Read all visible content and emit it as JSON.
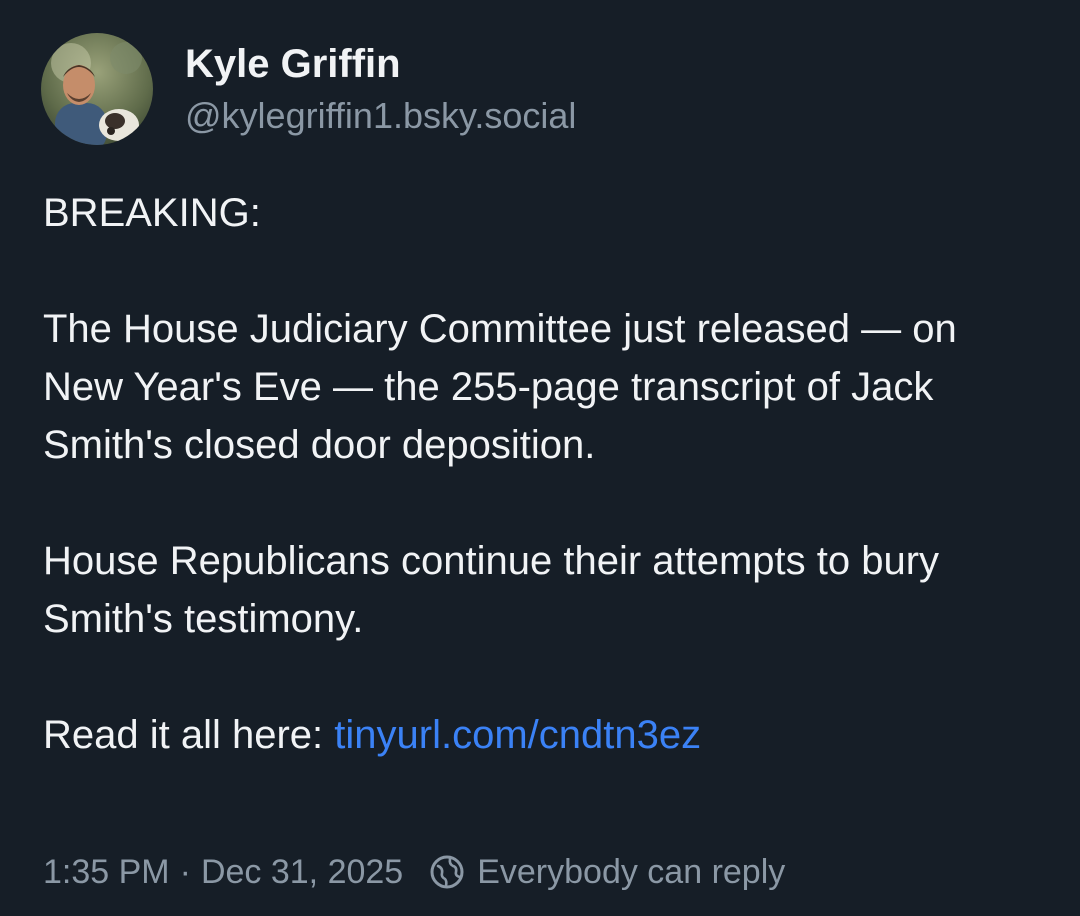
{
  "author": {
    "display_name": "Kyle Griffin",
    "handle": "@kylegriffin1.bsky.social",
    "avatar_icon": "profile-photo"
  },
  "post": {
    "heading": "BREAKING:",
    "paragraph_1": "The House Judiciary Committee just released — on New Year's Eve — the 255-page transcript of Jack Smith's closed door deposition.",
    "paragraph_2": "House Republicans continue their attempts to bury Smith's testimony.",
    "read_prefix": "Read it all here: ",
    "link_text": "tinyurl.com/cndtn3ez"
  },
  "meta": {
    "time": "1:35 PM",
    "separator": "·",
    "date": "Dec 31, 2025",
    "reply_icon": "globe-icon",
    "reply_setting": "Everybody can reply"
  },
  "colors": {
    "background": "#161e27",
    "text": "#f1f3f5",
    "muted": "#8b98a5",
    "link": "#3b82f6"
  }
}
